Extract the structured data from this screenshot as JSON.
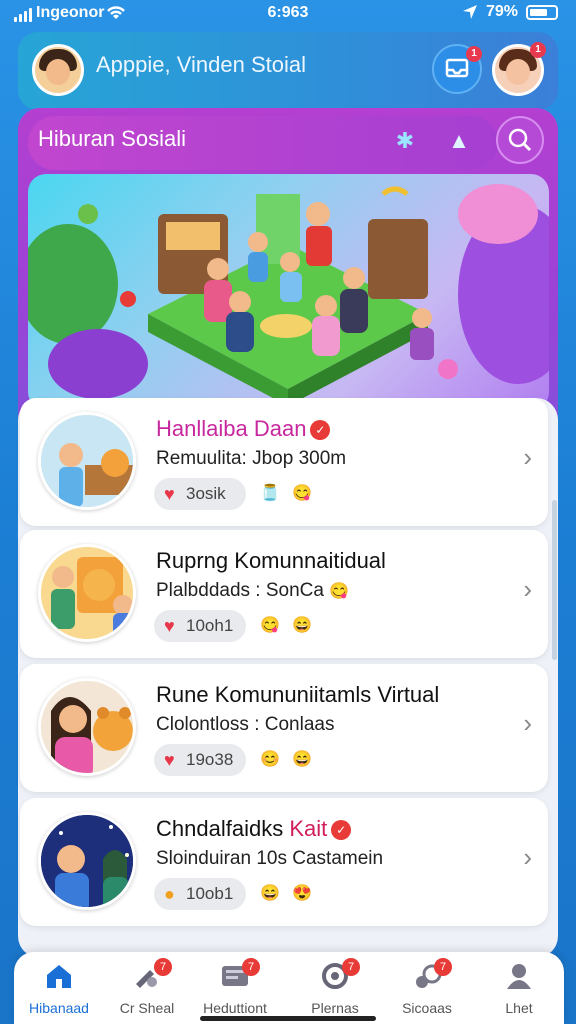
{
  "status": {
    "carrier": "Ingeonor",
    "time": "6:963",
    "battery": "79%"
  },
  "header": {
    "title": "Apppie, Vinden Stoial",
    "notif_badge": "1",
    "avatar_badge": "1"
  },
  "panel": {
    "title": "Hiburan Sosiali"
  },
  "items": [
    {
      "title": "Hanllaiba Daan",
      "title_color": "#c7289e",
      "verified": true,
      "subtitle": "Remuulita: Jbop 300m",
      "chip": "3osik",
      "emojis": [
        "🫙",
        "😋"
      ]
    },
    {
      "title": "Ruprng Komunnaitidual",
      "title_color": "#121212",
      "verified": false,
      "subtitle": "Plalbddads : SonCa",
      "subtitle_emoji": "😋",
      "chip": "10oh1",
      "emojis": [
        "😋",
        "😄"
      ]
    },
    {
      "title": "Rune Komununiitamls Virtual",
      "title_color": "#121212",
      "verified": false,
      "subtitle": "Clolontloss : Conlaas",
      "chip": "19o38",
      "emojis": [
        "😊",
        "😄"
      ]
    },
    {
      "title": "Chndalfaidks",
      "title_accent": "Kait",
      "title_color": "#121212",
      "accent_color": "#d01e5c",
      "verified": true,
      "subtitle": "Sloinduiran 10s Castamein",
      "chip": "10ob1",
      "emojis": [
        "😄",
        "😍"
      ]
    }
  ],
  "nav": [
    {
      "label": "Hibanaad",
      "icon": "home-icon",
      "active": true,
      "badge": ""
    },
    {
      "label": "Cr Sheal",
      "icon": "paint-icon",
      "active": false,
      "badge": "7"
    },
    {
      "label": "Heduttiont",
      "icon": "gallery-icon",
      "active": false,
      "badge": "7"
    },
    {
      "label": "Plernas",
      "icon": "planet-icon",
      "active": false,
      "badge": "7"
    },
    {
      "label": "Sicoaas",
      "icon": "music-icon",
      "active": false,
      "badge": "7"
    },
    {
      "label": "Lhet",
      "icon": "profile-icon",
      "active": false,
      "badge": ""
    }
  ],
  "colors": {
    "accent": "#1a6fd6",
    "panel": "#a843d4",
    "badge": "#e83a36"
  }
}
